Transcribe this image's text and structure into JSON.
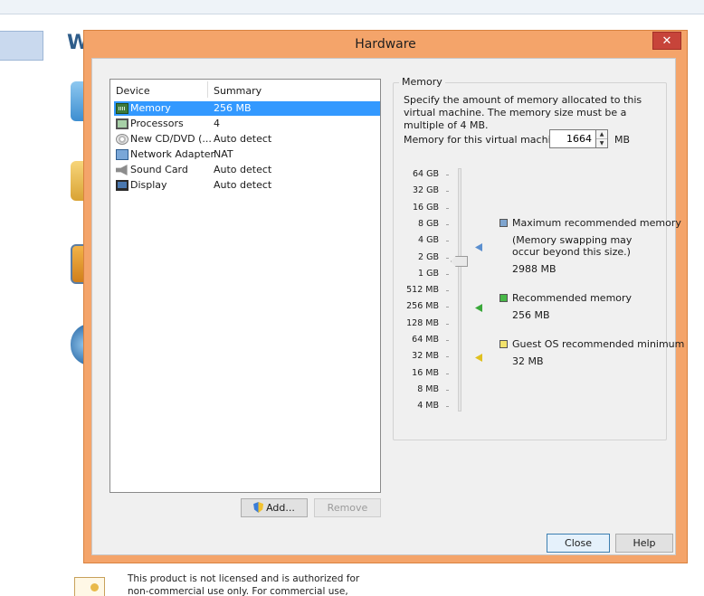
{
  "background": {
    "heading_letter": "W",
    "license_notice": "This product is not licensed and is authorized for non-commercial use only. For commercial use,"
  },
  "dialog": {
    "title": "Hardware",
    "close_glyph": "✕"
  },
  "device_list": {
    "col_device": "Device",
    "col_summary": "Summary",
    "rows": [
      {
        "device": "Memory",
        "summary": "256 MB",
        "icon": "memory-icon"
      },
      {
        "device": "Processors",
        "summary": "4",
        "icon": "processor-icon"
      },
      {
        "device": "New CD/DVD (...",
        "summary": "Auto detect",
        "icon": "cd-dvd-icon"
      },
      {
        "device": "Network Adapter",
        "summary": "NAT",
        "icon": "network-adapter-icon"
      },
      {
        "device": "Sound Card",
        "summary": "Auto detect",
        "icon": "sound-card-icon"
      },
      {
        "device": "Display",
        "summary": "Auto detect",
        "icon": "display-icon"
      }
    ],
    "add_label": "Add...",
    "remove_label": "Remove"
  },
  "memory": {
    "group_label": "Memory",
    "description": "Specify the amount of memory allocated to this virtual machine. The memory size must be a multiple of 4 MB.",
    "field_label": "Memory for this virtual machine:",
    "value": "1664",
    "unit": "MB",
    "scale": [
      "64 GB",
      "32 GB",
      "16 GB",
      "8 GB",
      "4 GB",
      "2 GB",
      "1 GB",
      "512 MB",
      "256 MB",
      "128 MB",
      "64 MB",
      "32 MB",
      "16 MB",
      "8 MB",
      "4 MB"
    ],
    "max_recommended": {
      "label": "Maximum recommended memory",
      "note": "(Memory swapping may occur beyond this size.)",
      "value": "2988 MB",
      "color": "#5b8fcf"
    },
    "recommended": {
      "label": "Recommended memory",
      "value": "256 MB",
      "color": "#3aa83a"
    },
    "guest_min": {
      "label": "Guest OS recommended minimum",
      "value": "32 MB",
      "color": "#e0c020"
    }
  },
  "footer": {
    "close_label": "Close",
    "help_label": "Help"
  }
}
